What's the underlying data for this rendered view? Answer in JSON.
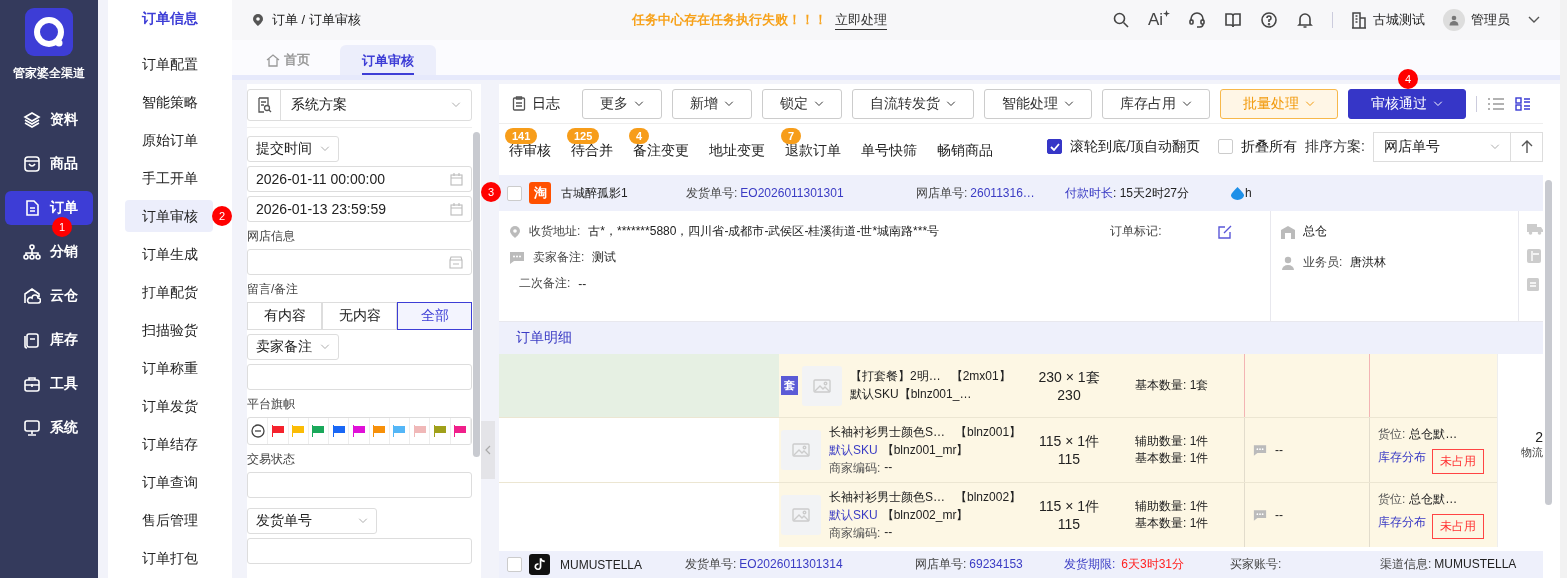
{
  "nav": {
    "logo_text": "管家婆全渠道",
    "items": [
      {
        "label": "资料",
        "selected": false
      },
      {
        "label": "商品",
        "selected": false
      },
      {
        "label": "订单",
        "selected": true,
        "marker": "1"
      },
      {
        "label": "分销",
        "selected": false
      },
      {
        "label": "云仓",
        "selected": false
      },
      {
        "label": "库存",
        "selected": false
      },
      {
        "label": "工具",
        "selected": false
      },
      {
        "label": "系统",
        "selected": false
      }
    ]
  },
  "submenu": {
    "heading": "订单信息",
    "items": [
      {
        "label": "订单配置",
        "selected": false
      },
      {
        "label": "智能策略",
        "selected": false
      },
      {
        "label": "原始订单",
        "selected": false
      },
      {
        "label": "手工开单",
        "selected": false
      },
      {
        "label": "订单审核",
        "selected": true,
        "marker": "2"
      },
      {
        "label": "订单生成",
        "selected": false
      },
      {
        "label": "打单配货",
        "selected": false
      },
      {
        "label": "扫描验货",
        "selected": false
      },
      {
        "label": "订单称重",
        "selected": false
      },
      {
        "label": "订单发货",
        "selected": false
      },
      {
        "label": "订单结存",
        "selected": false
      },
      {
        "label": "订单查询",
        "selected": false
      },
      {
        "label": "售后管理",
        "selected": false
      },
      {
        "label": "订单打包",
        "selected": false
      }
    ]
  },
  "topbar": {
    "breadcrumb": "订单 / 订单审核",
    "alert": "任务中心存在任务执行失败！！！",
    "alert_action": "立即处理",
    "ai_label": "Ai",
    "company": "古城测试",
    "user": "管理员"
  },
  "page_tabs": [
    {
      "label": "首页",
      "selected": false
    },
    {
      "label": "订单审核",
      "selected": true
    }
  ],
  "filter": {
    "scheme": "系统方案",
    "time_field": "提交时间",
    "start": "2026-01-11 00:00:00",
    "end": "2026-01-13 23:59:59",
    "shop_label": "网店信息",
    "memo_label": "留言/备注",
    "memo_options": [
      {
        "label": "有内容",
        "selected": false
      },
      {
        "label": "无内容",
        "selected": false
      },
      {
        "label": "全部",
        "selected": true
      }
    ],
    "remark_field": "卖家备注",
    "flag_label": "平台旗帜",
    "flags": [
      {
        "color": "#f5222d"
      },
      {
        "color": "#fbbc05"
      },
      {
        "color": "#1aa85a"
      },
      {
        "color": "#1967f5"
      },
      {
        "color": "#e010d8"
      },
      {
        "color": "#f79009"
      },
      {
        "color": "#54b6f7"
      },
      {
        "color": "#f0b8b8"
      },
      {
        "color": "#a0a01a"
      },
      {
        "color": "#f01f8a"
      }
    ],
    "trade_label": "交易状态",
    "number_field": "发货单号"
  },
  "toolbar": {
    "log": "日志",
    "buttons": [
      {
        "label": "更多",
        "kind": "default"
      },
      {
        "label": "新增",
        "kind": "default"
      },
      {
        "label": "锁定",
        "kind": "default"
      },
      {
        "label": "自流转发货",
        "kind": "default"
      },
      {
        "label": "智能处理",
        "kind": "default"
      },
      {
        "label": "库存占用",
        "kind": "default"
      },
      {
        "label": "批量处理",
        "kind": "warning"
      },
      {
        "label": "审核通过",
        "kind": "primary",
        "marker": "4"
      }
    ]
  },
  "quick_tabs": [
    {
      "label": "待审核",
      "count": "141"
    },
    {
      "label": "待合并",
      "count": "125"
    },
    {
      "label": "备注变更",
      "count": "4"
    },
    {
      "label": "地址变更"
    },
    {
      "label": "退款订单",
      "count": "7"
    },
    {
      "label": "单号快筛"
    },
    {
      "label": "畅销商品"
    }
  ],
  "options": [
    {
      "label": "滚轮到底/顶自动翻页",
      "checked": true
    },
    {
      "label": "折叠所有",
      "checked": false
    }
  ],
  "sort": {
    "label": "排序方案:",
    "value": "网店单号"
  },
  "orders": [
    {
      "platform_glyph": "淘",
      "shop": "古城醉孤影1",
      "checked": false,
      "marker": "3",
      "tag": "h",
      "fields": [
        {
          "label": "发货单号:",
          "value": "EO2026011301301",
          "kind": "link"
        },
        {
          "label": "网店单号:",
          "value": "26011316…",
          "kind": "link"
        },
        {
          "label": "付款时长",
          "value": ": 15天2时27分",
          "kind": "timer"
        }
      ],
      "body": {
        "address_label": "收货地址:",
        "address": "古*，*******5880，四川省-成都市-武侯区-桂溪街道-世*城南路***号",
        "seller_memo_label": "卖家备注:",
        "seller_memo": "测试",
        "second_memo_label": "二次备注:",
        "second_memo": "--",
        "mark_label": "订单标记:",
        "warehouse": "总仓",
        "salesman_label": "业务员:",
        "salesman": "唐洪林"
      },
      "detail_heading": "订单明细",
      "items": [
        {
          "kind": "bundle",
          "badge": "套",
          "name": "【打套餐】2明…",
          "code": "【2mx01】",
          "sku": "默认SKU【blnz001_…",
          "qty": "230 × 1套",
          "total": "230",
          "base": "基本数量:  1套"
        },
        {
          "kind": "item",
          "name": "长袖衬衫男士颜色S…",
          "code": "【blnz001】",
          "sku_label": "默认SKU",
          "sku": "【blnz001_mr】",
          "merchant_label": "商家编码:",
          "merchant": "--",
          "qty": "115 × 1件",
          "total": "115",
          "aux": "辅助数量: 1件",
          "base": "基本数量: 1件",
          "comment": "--",
          "location_label": "货位:",
          "location": "总仓默…",
          "stock_link": "库存分布",
          "status": "未占用"
        },
        {
          "kind": "item",
          "name": "长袖衬衫男士颜色S…",
          "code": "【blnz002】",
          "sku_label": "默认SKU",
          "sku": "【blnz002_mr】",
          "merchant_label": "商家编码:",
          "merchant": "--",
          "qty": "115 × 1件",
          "total": "115",
          "aux": "辅助数量: 1件",
          "base": "基本数量: 1件",
          "comment": "--",
          "location_label": "货位:",
          "location": "总仓默…",
          "stock_link": "库存分布",
          "status": "未占用"
        }
      ],
      "summary": {
        "value": "2",
        "label": "物流"
      }
    },
    {
      "shop": "MUMUSTELLA",
      "checked": false,
      "fields": [
        {
          "label": "发货单号:",
          "value": "EO2026011301314",
          "kind": "link"
        },
        {
          "label": "网店单号:",
          "value": "69234153",
          "kind": "link"
        },
        {
          "label": "发货期限:",
          "value": "6天3时31分",
          "kind": "deadline"
        },
        {
          "label": "买家账号:",
          "kind": "plain"
        },
        {
          "label": "渠道信息:",
          "value": "MUMUSTELLA",
          "kind": "plain"
        }
      ]
    }
  ]
}
